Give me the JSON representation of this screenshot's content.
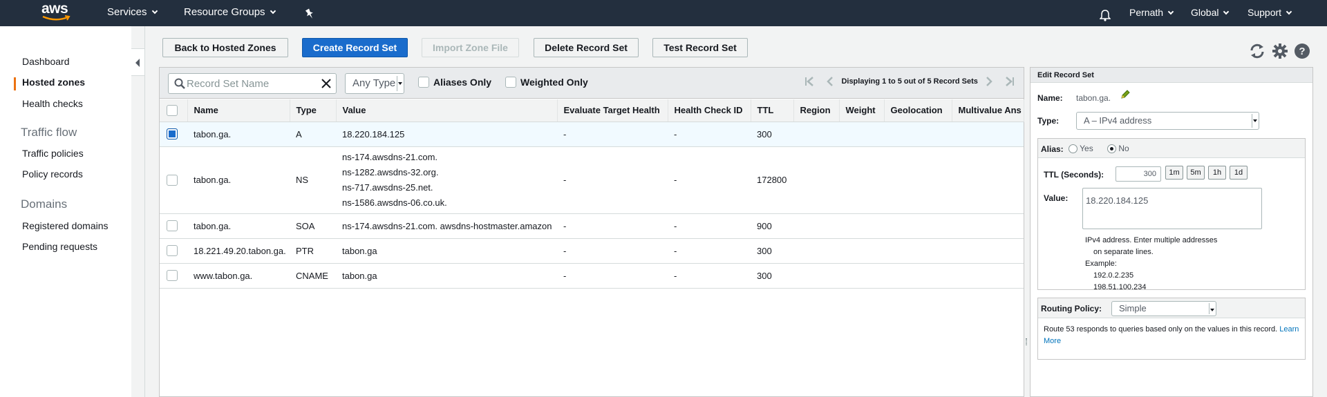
{
  "topnav": {
    "logo": "aws",
    "services": "Services",
    "resource_groups": "Resource Groups",
    "user": "Pernath",
    "region": "Global",
    "support": "Support"
  },
  "sidebar": {
    "dashboard": "Dashboard",
    "hosted_zones": "Hosted zones",
    "health_checks": "Health checks",
    "traffic_flow_header": "Traffic flow",
    "traffic_policies": "Traffic policies",
    "policy_records": "Policy records",
    "domains_header": "Domains",
    "registered_domains": "Registered domains",
    "pending_requests": "Pending requests"
  },
  "toolbar": {
    "back": "Back to Hosted Zones",
    "create": "Create Record Set",
    "import": "Import Zone File",
    "delete": "Delete Record Set",
    "test": "Test Record Set"
  },
  "filters": {
    "search_placeholder": "Record Set Name",
    "type": "Any Type",
    "aliases_only": "Aliases Only",
    "weighted_only": "Weighted Only",
    "pager": "Displaying 1 to 5 out of 5 Record Sets"
  },
  "table": {
    "columns": [
      "Name",
      "Type",
      "Value",
      "Evaluate Target Health",
      "Health Check ID",
      "TTL",
      "Region",
      "Weight",
      "Geolocation",
      "Multivalue Ans"
    ],
    "rows": [
      {
        "name": "tabon.ga.",
        "type": "A",
        "value": [
          "18.220.184.125"
        ],
        "eval": "-",
        "hc": "-",
        "ttl": "300",
        "selected": true
      },
      {
        "name": "tabon.ga.",
        "type": "NS",
        "value": [
          "ns-174.awsdns-21.com.",
          "ns-1282.awsdns-32.org.",
          "ns-717.awsdns-25.net.",
          "ns-1586.awsdns-06.co.uk."
        ],
        "eval": "-",
        "hc": "-",
        "ttl": "172800",
        "selected": false
      },
      {
        "name": "tabon.ga.",
        "type": "SOA",
        "value": [
          "ns-174.awsdns-21.com. awsdns-hostmaster.amazon"
        ],
        "eval": "-",
        "hc": "-",
        "ttl": "900",
        "selected": false
      },
      {
        "name": "18.221.49.20.tabon.ga.",
        "type": "PTR",
        "value": [
          "tabon.ga"
        ],
        "eval": "-",
        "hc": "-",
        "ttl": "300",
        "selected": false
      },
      {
        "name": "www.tabon.ga.",
        "type": "CNAME",
        "value": [
          "tabon.ga"
        ],
        "eval": "-",
        "hc": "-",
        "ttl": "300",
        "selected": false
      }
    ]
  },
  "edit": {
    "header": "Edit Record Set",
    "name_label": "Name:",
    "name_value": "tabon.ga.",
    "type_label": "Type:",
    "type_value": "A – IPv4 address",
    "alias_label": "Alias:",
    "alias_yes": "Yes",
    "alias_no": "No",
    "ttl_label": "TTL (Seconds):",
    "ttl_value": "300",
    "ttl_buttons": [
      "1m",
      "5m",
      "1h",
      "1d"
    ],
    "value_label": "Value:",
    "value_text": "18.220.184.125",
    "help_line1": "IPv4 address. Enter multiple addresses",
    "help_line2": "on separate lines.",
    "help_example": "Example:",
    "help_ex1": "192.0.2.235",
    "help_ex2": "198.51.100.234",
    "routing_label": "Routing Policy:",
    "routing_value": "Simple",
    "routing_help": "Route 53 responds to queries based only on the values in this record.",
    "learn": "Learn",
    "more": "More"
  }
}
